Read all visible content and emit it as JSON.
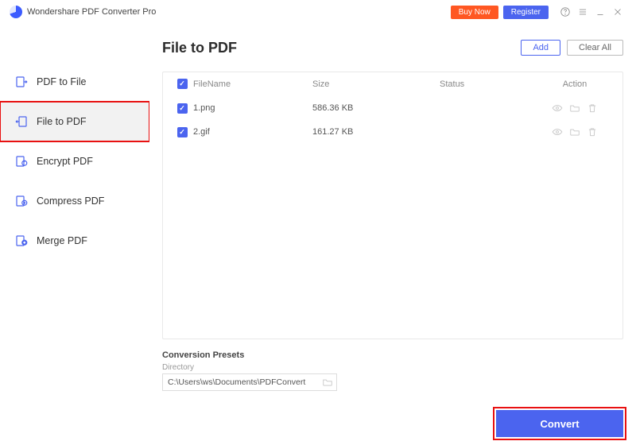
{
  "titlebar": {
    "app_name": "Wondershare PDF Converter Pro",
    "buy_label": "Buy Now",
    "register_label": "Register"
  },
  "sidebar": {
    "items": [
      {
        "label": "PDF to File"
      },
      {
        "label": "File to PDF"
      },
      {
        "label": "Encrypt PDF"
      },
      {
        "label": "Compress PDF"
      },
      {
        "label": "Merge PDF"
      }
    ]
  },
  "main": {
    "title": "File to PDF",
    "add_label": "Add",
    "clear_label": "Clear All",
    "columns": {
      "name": "FileName",
      "size": "Size",
      "status": "Status",
      "action": "Action"
    },
    "rows": [
      {
        "name": "1.png",
        "size": "586.36 KB"
      },
      {
        "name": "2.gif",
        "size": "161.27 KB"
      }
    ]
  },
  "footer": {
    "presets_title": "Conversion Presets",
    "directory_label": "Directory",
    "directory_value": "C:\\Users\\ws\\Documents\\PDFConvert",
    "convert_label": "Convert"
  }
}
